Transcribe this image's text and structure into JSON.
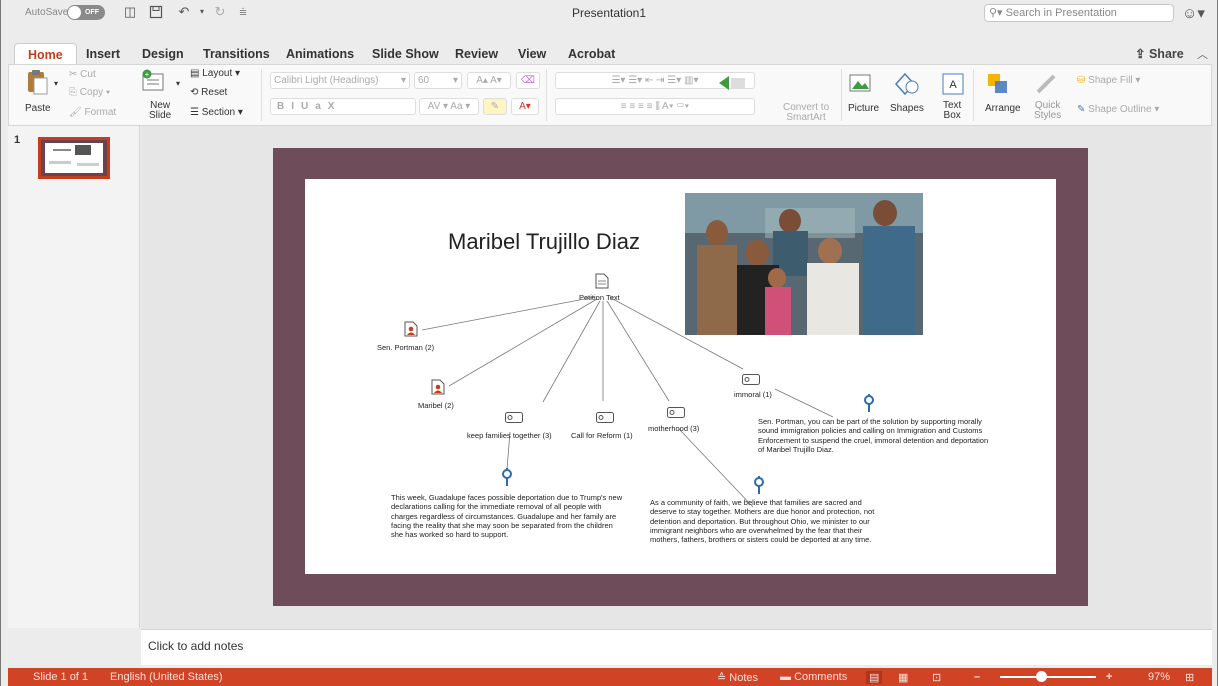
{
  "titlebar": {
    "autosave_label": "AutoSave",
    "autosave_state": "OFF",
    "document_title": "Presentation1",
    "search_placeholder": "Search in Presentation"
  },
  "tabs": [
    {
      "label": "Home",
      "active": true
    },
    {
      "label": "Insert"
    },
    {
      "label": "Design"
    },
    {
      "label": "Transitions"
    },
    {
      "label": "Animations"
    },
    {
      "label": "Slide Show"
    },
    {
      "label": "Review"
    },
    {
      "label": "View"
    },
    {
      "label": "Acrobat"
    }
  ],
  "share_label": "Share",
  "ribbon": {
    "paste": "Paste",
    "cut": "Cut",
    "copy": "Copy",
    "format": "Format",
    "new_slide": [
      "New",
      "Slide"
    ],
    "layout": "Layout",
    "reset": "Reset",
    "section": "Section",
    "font_name": "Calibri Light (Headings)",
    "font_size": "60",
    "convert_smartart": [
      "Convert to",
      "SmartArt"
    ],
    "picture": "Picture",
    "shapes": "Shapes",
    "text_box": [
      "Text",
      "Box"
    ],
    "arrange": "Arrange",
    "quick_styles": [
      "Quick",
      "Styles"
    ],
    "shape_fill": "Shape Fill",
    "shape_outline": "Shape Outline"
  },
  "thumbnails": {
    "slide_number": "1"
  },
  "slide": {
    "title": "Maribel Trujillo Diaz",
    "nodes": {
      "petition": "Petition Text",
      "portman": "Sen. Portman (2)",
      "maribel": "Maribel (2)",
      "keep_families": "keep families together (3)",
      "call_reform": "Call for Reform (1)",
      "motherhood": "motherhood (3)",
      "immoral": "immoral (1)"
    },
    "paragraphs": {
      "guadalupe": "This week, Guadalupe faces possible deportation due to Trump's new declarations calling for the immediate removal of all people with charges regardless of circumstances. Guadalupe and her family are facing the reality that she may soon be separated from the children she has worked so hard to support.",
      "faith": "As a community of faith, we believe that families are sacred and deserve to stay together. Mothers are due honor and protection, not detention and deportation. But throughout Ohio, we minister to our immigrant neighbors who are overwhelmed by the fear that their mothers, fathers, brothers or sisters could be deported at any time.",
      "portman": "Sen. Portman, you can be part of the solution by supporting morally sound immigration policies and calling on Immigration and Customs Enforcement to suspend the cruel, immoral detention and deportation of Maribel Trujillo Diaz."
    }
  },
  "notes": {
    "placeholder": "Click to add notes"
  },
  "statusbar": {
    "slide_info": "Slide 1 of 1",
    "language": "English (United States)",
    "notes": "Notes",
    "comments": "Comments",
    "zoom": "97%",
    "zoom_level": 0.43
  },
  "colors": {
    "accent": "#d04425",
    "slide_frame": "#6f4c59",
    "pin": "#2b6cb0"
  }
}
